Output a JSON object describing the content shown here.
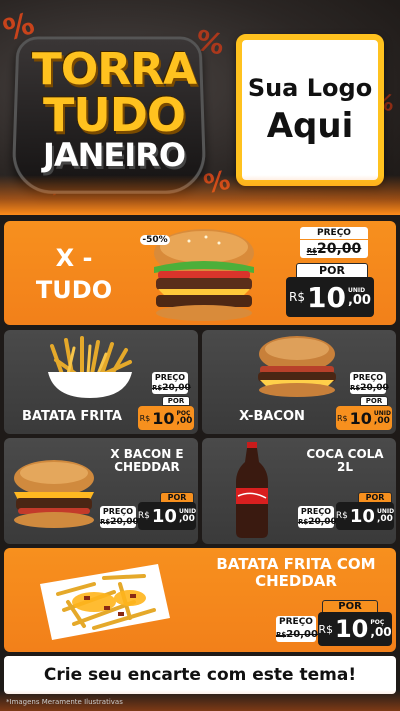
{
  "header": {
    "title_line1": "TORRA",
    "title_line2": "TUDO",
    "title_line3": "JANEIRO",
    "percent_symbol": "%",
    "logo_line1": "Sua Logo",
    "logo_line2": "Aqui"
  },
  "colors": {
    "accent": "#f7901e",
    "title_yellow": "#ffc21f",
    "dark": "#1a1a1a",
    "card_grey": "#444444"
  },
  "products": [
    {
      "name_line1": "X -",
      "name_line2": "TUDO",
      "discount": "-50%",
      "preco_label": "PREÇO",
      "old_currency": "R$",
      "old_price": "20,00",
      "por_label": "POR",
      "currency": "R$",
      "price_int": "10",
      "price_dec": ",00",
      "unit": "UNID",
      "icon": "burger-icon"
    },
    {
      "name": "BATATA FRITA",
      "preco_label": "PREÇO",
      "old_currency": "R$",
      "old_price": "20,00",
      "por_label": "POR",
      "currency": "R$",
      "price_int": "10",
      "price_dec": ",00",
      "unit": "POÇ",
      "icon": "fries-icon"
    },
    {
      "name": "X-BACON",
      "preco_label": "PREÇO",
      "old_currency": "R$",
      "old_price": "20,00",
      "por_label": "POR",
      "currency": "R$",
      "price_int": "10",
      "price_dec": ",00",
      "unit": "UNID",
      "icon": "burger-icon"
    },
    {
      "name_line1": "X BACON E",
      "name_line2": "CHEDDAR",
      "preco_label": "PREÇO",
      "old_currency": "R$",
      "old_price": "20,00",
      "por_label": "POR",
      "currency": "R$",
      "price_int": "10",
      "price_dec": ",00",
      "unit": "UNID",
      "icon": "burger-icon"
    },
    {
      "name_line1": "COCA COLA",
      "name_line2": "2L",
      "preco_label": "PREÇO",
      "old_currency": "R$",
      "old_price": "20,00",
      "por_label": "POR",
      "currency": "R$",
      "price_int": "10",
      "price_dec": ",00",
      "unit": "UNID",
      "icon": "soda-bottle-icon"
    },
    {
      "name_line1": "BATATA FRITA COM",
      "name_line2": "CHEDDAR",
      "preco_label": "PREÇO",
      "old_currency": "R$",
      "old_price": "20,00",
      "por_label": "POR",
      "currency": "R$",
      "price_int": "10",
      "price_dec": ",00",
      "unit": "POÇ",
      "icon": "fries-plate-icon"
    }
  ],
  "footer": {
    "cta": "Crie seu encarte com este tema!",
    "disclaimer": "*Imagens Meramente Ilustrativas"
  }
}
